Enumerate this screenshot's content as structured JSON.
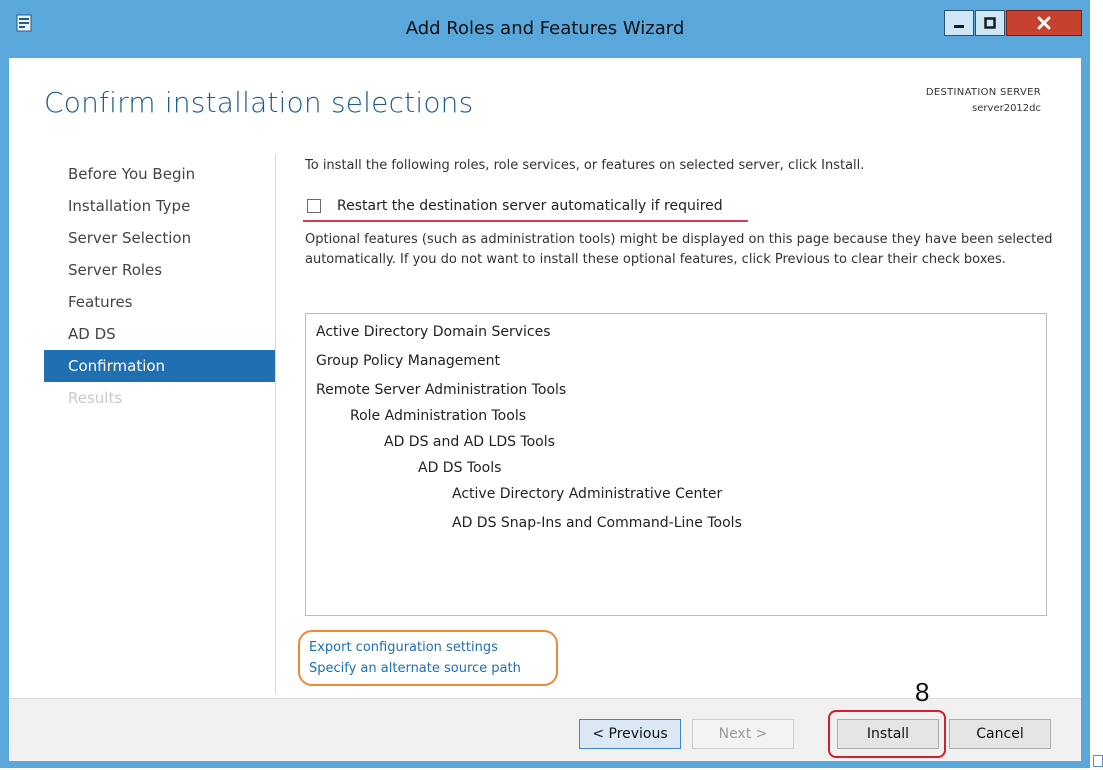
{
  "window": {
    "title": "Add Roles and Features Wizard",
    "controls": {
      "minimize": "minimize-icon",
      "maximize": "maximize-icon",
      "close": "close-icon"
    }
  },
  "header": {
    "page_title": "Confirm installation selections",
    "destination_label": "DESTINATION SERVER",
    "destination_name": "server2012dc"
  },
  "nav": {
    "items": [
      {
        "label": "Before You Begin"
      },
      {
        "label": "Installation Type"
      },
      {
        "label": "Server Selection"
      },
      {
        "label": "Server Roles"
      },
      {
        "label": "Features"
      },
      {
        "label": "AD DS"
      },
      {
        "label": "Confirmation"
      },
      {
        "label": "Results"
      }
    ]
  },
  "content": {
    "intro": "To install the following roles, role services, or features on selected server, click Install.",
    "restart_label": "Restart the destination server automatically if required",
    "restart_checked": false,
    "optional_text": "Optional features (such as administration tools) might be displayed on this page because they have been selected automatically. If you do not want to install these optional features, click Previous to clear their check boxes.",
    "features": [
      {
        "label": "Active Directory Domain Services",
        "level": 0
      },
      {
        "label": "Group Policy Management",
        "level": 0
      },
      {
        "label": "Remote Server Administration Tools",
        "level": 0
      },
      {
        "label": "Role Administration Tools",
        "level": 1
      },
      {
        "label": "AD DS and AD LDS Tools",
        "level": 2
      },
      {
        "label": "AD DS Tools",
        "level": 3
      },
      {
        "label": "Active Directory Administrative Center",
        "level": 4
      },
      {
        "label": "AD DS Snap-Ins and Command-Line Tools",
        "level": 4
      }
    ],
    "links": {
      "export": "Export configuration settings",
      "alternate_source": "Specify an alternate source path"
    }
  },
  "footer": {
    "previous": "< Previous",
    "next": "Next >",
    "install": "Install",
    "cancel": "Cancel"
  },
  "annotation": {
    "step_number": "8"
  },
  "colors": {
    "titlebar": "#5aa7dc",
    "accent": "#1f6fb1",
    "close_button": "#c7412f",
    "highlight_red": "#d0202a",
    "highlight_orange": "#ee8a3a"
  }
}
